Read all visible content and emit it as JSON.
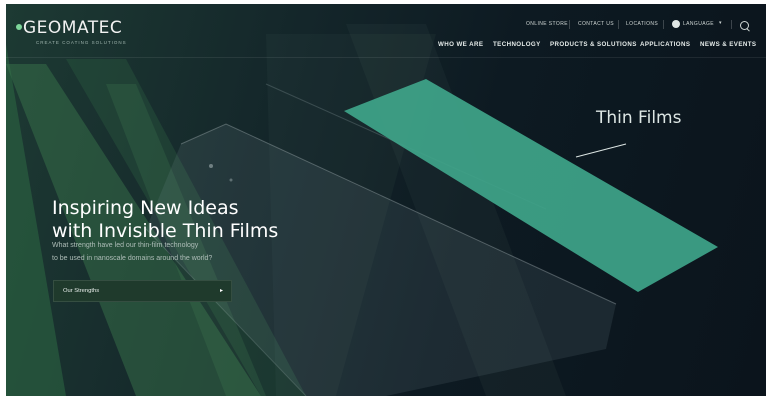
{
  "brand": {
    "logo_text": "GEOMATEC",
    "tagline": "CREATE COATING SOLUTIONS",
    "accent_color": "#7dd69a"
  },
  "utility_nav": {
    "online_store": "ONLINE STORE",
    "contact_us": "CONTACT US",
    "locations": "LOCATIONS",
    "language": "LANGUAGE",
    "language_icon": "globe-icon",
    "search_icon": "search-icon"
  },
  "main_nav": [
    {
      "label": "WHO WE ARE"
    },
    {
      "label": "TECHNOLOGY"
    },
    {
      "label": "PRODUCTS & SOLUTIONS"
    },
    {
      "label": "APPLICATIONS"
    },
    {
      "label": "NEWS & EVENTS"
    }
  ],
  "hero": {
    "title_line1": "Inspiring New Ideas",
    "title_line2": "with Invisible Thin Films",
    "subtitle_line1": "What strength have led our thin-film technology",
    "subtitle_line2": "to be used in nanoscale domains around the world?",
    "cta_label": "Our Strengths",
    "cta_icon": "play-arrow-icon"
  },
  "illustration": {
    "annotation": "Thin Films",
    "film_color": "#3fa58a"
  }
}
